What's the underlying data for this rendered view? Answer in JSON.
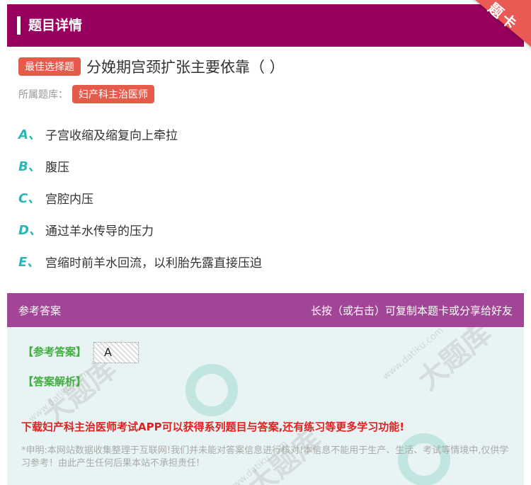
{
  "header": {
    "title": "题目详情"
  },
  "ribbon": {
    "text": "题卡"
  },
  "question": {
    "type_badge": "最佳选择题",
    "text": "分娩期宫颈扩张主要依靠（ ）",
    "library_label": "所属题库：",
    "library_badge": "妇产科主治医师"
  },
  "options": [
    {
      "letter": "A、",
      "text": "子宫收缩及缩复向上牵拉"
    },
    {
      "letter": "B、",
      "text": "腹压"
    },
    {
      "letter": "C、",
      "text": "宫腔内压"
    },
    {
      "letter": "D、",
      "text": "通过羊水传导的压力"
    },
    {
      "letter": "E、",
      "text": "宫缩时前羊水回流，以利胎先露直接压迫"
    }
  ],
  "answer_section": {
    "title": "参考答案",
    "hint": "长按（或右击）可复制本题卡或分享给好友",
    "answer_label": "【参考答案】",
    "answer_value": "A",
    "analysis_label": "【答案解析】",
    "promo": "下载妇产科主治医师考试APP可以获得系列题目与答案,还有练习等更多学习功能!",
    "disclaimer": "*申明:本网站数据收集整理于互联网!我们并未能对答案信息进行核对!本信息不能用于生产、生活、考试等情境中,仅供学习参考！由此产生任何后果本站不承担责任!"
  },
  "watermark": {
    "text": "大题库",
    "url": "www.datiku.com"
  },
  "colors": {
    "header": "#98005f",
    "answer_head": "#a24596",
    "badge": "#e45b4a",
    "option_letter": "#29b6b6",
    "answer_green": "#3fae3f",
    "promo_red": "#e02020"
  }
}
